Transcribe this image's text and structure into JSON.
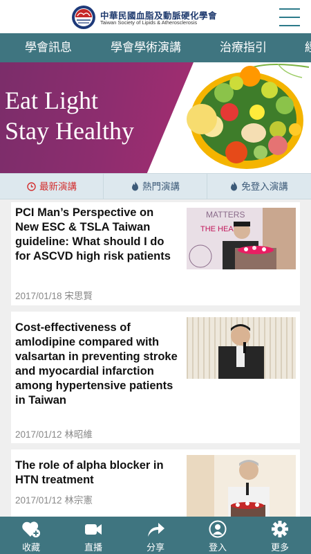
{
  "header": {
    "org_name_zh": "中華民國血脂及動脈硬化學會",
    "org_name_en": "Taiwan Society of Lipids & Atherosclerosis",
    "menu_icon": "hamburger-icon"
  },
  "nav": {
    "items": [
      {
        "label": "學會訊息"
      },
      {
        "label": "學會學術演講"
      },
      {
        "label": "治療指引"
      },
      {
        "label": "經"
      }
    ]
  },
  "banner": {
    "line1": "Eat Light",
    "line2": "Stay Healthy"
  },
  "tabs": [
    {
      "label": "最新演講",
      "icon": "clock-icon",
      "active": true
    },
    {
      "label": "熱門演講",
      "icon": "flame-icon",
      "active": false
    },
    {
      "label": "免登入演講",
      "icon": "flame-icon",
      "active": false
    }
  ],
  "articles": [
    {
      "title": "PCI Man’s Perspective on New ESC & TSLA Taiwan guideline: What should I do for ASCVD high risk patients",
      "meta": "2017/01/18 宋思賢",
      "thumb_text_1": "MATTERS",
      "thumb_text_2": "THE HEART"
    },
    {
      "title": "Cost-effectiveness of amlodipine compared with valsartan in preventing stroke and myocardial infarction among hypertensive patients in Taiwan",
      "meta": "2017/01/12 林昭維"
    },
    {
      "title": "The role of alpha blocker in HTN treatment",
      "meta": "2017/01/12 林宗憲"
    }
  ],
  "bottom_bar": [
    {
      "label": "收藏",
      "icon": "heart-plus-icon"
    },
    {
      "label": "直播",
      "icon": "video-camera-icon"
    },
    {
      "label": "分享",
      "icon": "share-arrow-icon"
    },
    {
      "label": "登入",
      "icon": "user-icon"
    },
    {
      "label": "更多",
      "icon": "gear-icon"
    }
  ],
  "colors": {
    "nav_bg": "#3f7580",
    "banner_purple": "#8e2d6f",
    "active_tab": "#d32f2f",
    "tab_bg": "#dde8ee"
  }
}
